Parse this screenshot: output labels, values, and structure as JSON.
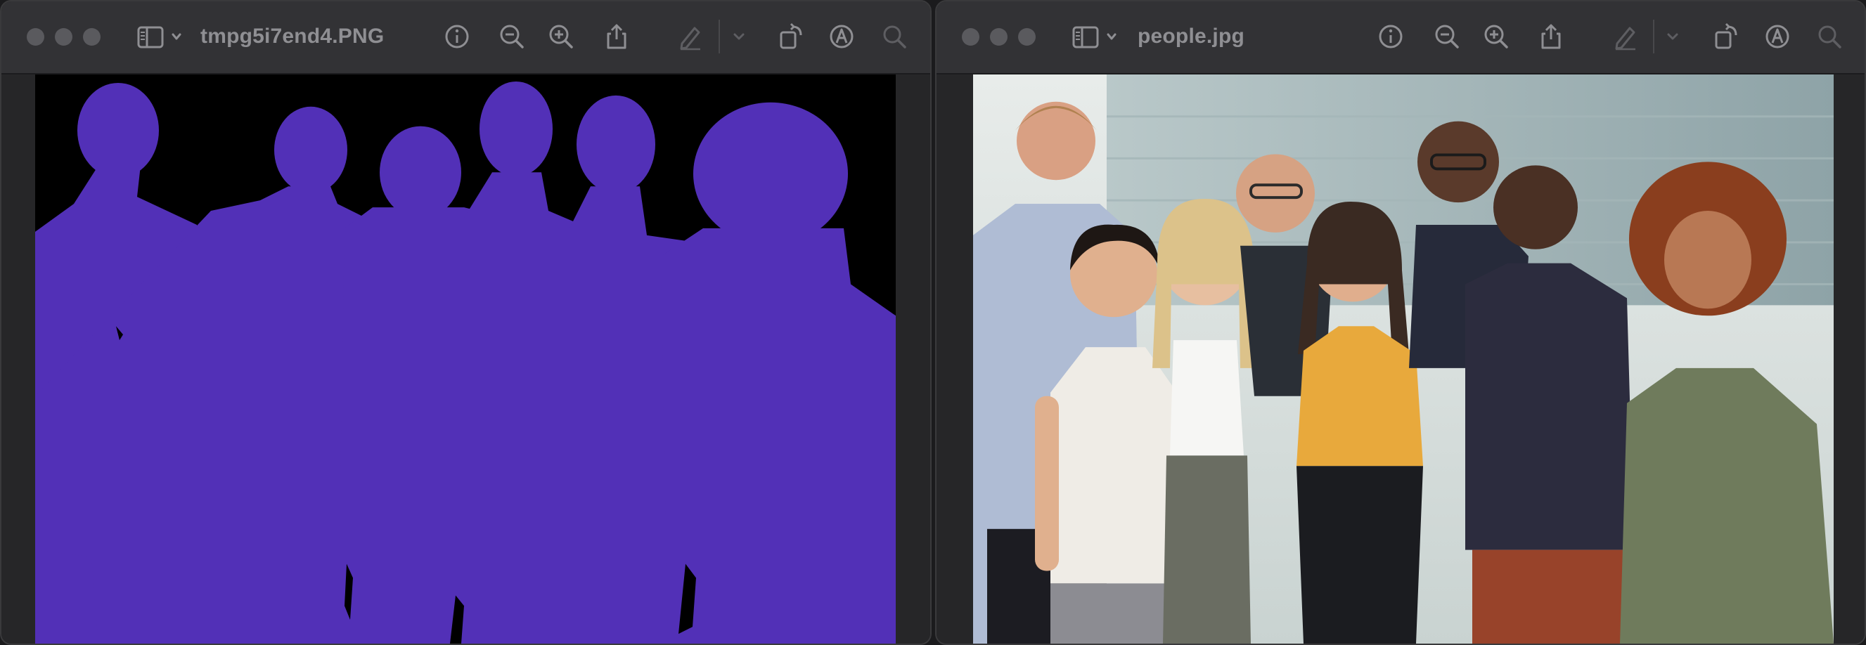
{
  "windows": [
    {
      "title": "tmpg5i7end4.PNG",
      "image_kind": "segmentation-mask",
      "colors": {
        "mask": "#5230b7",
        "background": "#000000"
      }
    },
    {
      "title": "people.jpg",
      "image_kind": "photo",
      "colors": {
        "sky": "#cfd8d6",
        "building": "#9fb3b6"
      }
    }
  ],
  "toolbar": {
    "icons": [
      "sidebar-toggle-icon",
      "chevron-down-icon",
      "info-icon",
      "zoom-out-icon",
      "zoom-in-icon",
      "share-icon",
      "markup-pen-icon",
      "chevron-down-icon",
      "rotate-icon",
      "markup-circle-icon",
      "search-icon"
    ]
  }
}
